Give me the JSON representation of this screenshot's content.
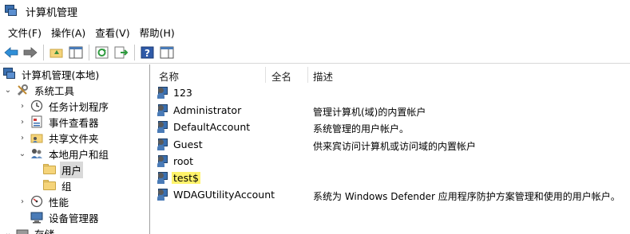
{
  "window": {
    "title": "计算机管理"
  },
  "menu": [
    "文件(F)",
    "操作(A)",
    "查看(V)",
    "帮助(H)"
  ],
  "tree": {
    "root": "计算机管理(本地)",
    "items": [
      {
        "label": "系统工具",
        "level": 1,
        "expanded": true
      },
      {
        "label": "任务计划程序",
        "level": 2
      },
      {
        "label": "事件查看器",
        "level": 2
      },
      {
        "label": "共享文件夹",
        "level": 2
      },
      {
        "label": "本地用户和组",
        "level": 2,
        "expanded": true
      },
      {
        "label": "用户",
        "level": 3,
        "selected": true
      },
      {
        "label": "组",
        "level": 3
      },
      {
        "label": "性能",
        "level": 2
      },
      {
        "label": "设备管理器",
        "level": 2
      },
      {
        "label": "存储",
        "level": 1
      }
    ]
  },
  "list": {
    "columns": [
      "名称",
      "全名",
      "描述"
    ],
    "rows": [
      {
        "name": "123",
        "fullname": "",
        "description": ""
      },
      {
        "name": "Administrator",
        "fullname": "",
        "description": "管理计算机(域)的内置帐户"
      },
      {
        "name": "DefaultAccount",
        "fullname": "",
        "description": "系统管理的用户帐户。"
      },
      {
        "name": "Guest",
        "fullname": "",
        "description": "供来宾访问计算机或访问域的内置帐户"
      },
      {
        "name": "root",
        "fullname": "",
        "description": ""
      },
      {
        "name": "test$",
        "fullname": "",
        "description": "",
        "highlighted": true
      },
      {
        "name": "WDAGUtilityAccount",
        "fullname": "",
        "description": "系统为 Windows Defender 应用程序防护方案管理和使用的用户帐户。"
      }
    ]
  },
  "colors": {
    "highlight": "#fff36b",
    "selected": "#d9d9d9",
    "accent": "#3a6fb0"
  }
}
